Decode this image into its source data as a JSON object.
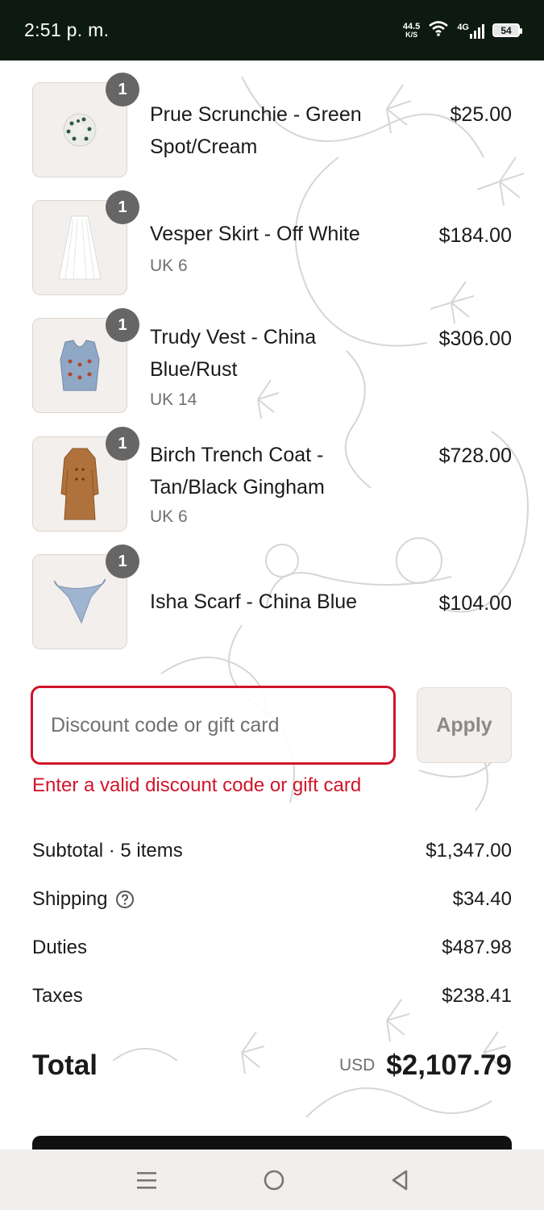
{
  "status_bar": {
    "time": "2:51 p. m.",
    "net_speed_value": "44.5",
    "net_speed_unit": "K/S",
    "network_type": "4G",
    "battery": "54"
  },
  "items": [
    {
      "title": "Prue Scrunchie - Green Spot/Cream",
      "variant": "",
      "price": "$25.00",
      "qty": "1",
      "image_icon": "scrunchie-icon"
    },
    {
      "title": "Vesper Skirt - Off White",
      "variant": "UK 6",
      "price": "$184.00",
      "qty": "1",
      "image_icon": "skirt-icon"
    },
    {
      "title": "Trudy Vest - China Blue/Rust",
      "variant": "UK 14",
      "price": "$306.00",
      "qty": "1",
      "image_icon": "vest-icon"
    },
    {
      "title": "Birch Trench Coat - Tan/Black Gingham",
      "variant": "UK 6",
      "price": "$728.00",
      "qty": "1",
      "image_icon": "coat-icon"
    },
    {
      "title": "Isha Scarf - China Blue",
      "variant": "",
      "price": "$104.00",
      "qty": "1",
      "image_icon": "scarf-icon"
    }
  ],
  "discount": {
    "placeholder": "Discount code or gift card",
    "apply_label": "Apply",
    "error": "Enter a valid discount code or gift card",
    "error_color": "#d0142a"
  },
  "summary": {
    "subtotal_label": "Subtotal · 5 items",
    "subtotal_value": "$1,347.00",
    "shipping_label": "Shipping",
    "shipping_value": "$34.40",
    "duties_label": "Duties",
    "duties_value": "$487.98",
    "taxes_label": "Taxes",
    "taxes_value": "$238.41",
    "total_label": "Total",
    "currency": "USD",
    "total_value": "$2,107.79"
  },
  "nav": {
    "icons": [
      "menu-icon",
      "home-circle-icon",
      "back-triangle-icon"
    ]
  }
}
